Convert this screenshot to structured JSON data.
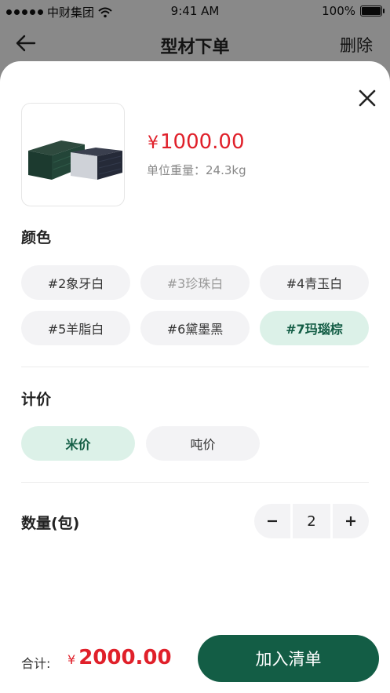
{
  "status_bar": {
    "carrier": "中财集团",
    "time": "9:41 AM",
    "battery": "100%"
  },
  "nav": {
    "title": "型材下单",
    "action": "删除"
  },
  "product": {
    "currency": "¥",
    "price": "1000.00",
    "unit_weight": "单位重量：24.3kg"
  },
  "color": {
    "title": "颜色",
    "options": [
      {
        "label": "#2象牙白",
        "state": "normal"
      },
      {
        "label": "#3珍珠白",
        "state": "disabled"
      },
      {
        "label": "#4青玉白",
        "state": "normal"
      },
      {
        "label": "#5羊脂白",
        "state": "normal"
      },
      {
        "label": "#6黛墨黑",
        "state": "normal"
      },
      {
        "label": "#7玛瑙棕",
        "state": "selected"
      }
    ]
  },
  "pricing": {
    "title": "计价",
    "options": [
      {
        "label": "米价",
        "state": "selected"
      },
      {
        "label": "吨价",
        "state": "normal"
      }
    ]
  },
  "quantity": {
    "label": "数量(包)",
    "value": "2"
  },
  "footer": {
    "total_label": "合计:",
    "currency": "¥",
    "total": "2000.00",
    "add_button": "加入清单"
  },
  "colors": {
    "accent": "#135d45",
    "accent_light": "#dcf1e8",
    "price_red": "#e0202a"
  }
}
